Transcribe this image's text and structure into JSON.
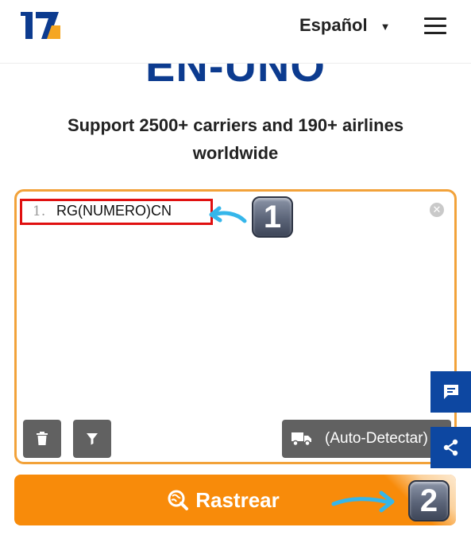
{
  "header": {
    "logo_text": "17",
    "language": "Español",
    "icons": {
      "menu": "hamburger-menu-icon",
      "caret": "caret-down-icon"
    }
  },
  "hero": {
    "title_fragment": "EN-UNO",
    "subtitle": "Support 2500+ carriers and 190+ airlines worldwide"
  },
  "tracking_input": {
    "line_number": "1.",
    "value": "RG(NUMERO)CN",
    "clear_icon": "clear-circle-icon"
  },
  "toolbar": {
    "delete_icon": "trash-icon",
    "filter_icon": "filter-icon",
    "carrier_label": "(Auto-Detectar)",
    "carrier_icon": "truck-icon"
  },
  "side_actions": {
    "chat_icon": "chat-icon",
    "share_icon": "share-icon"
  },
  "track_button": {
    "label": "Rastrear",
    "icon": "search-globe-icon"
  },
  "annotations": {
    "step1": "1",
    "step2": "2"
  },
  "colors": {
    "brand_blue": "#0c3b8f",
    "accent_orange": "#f88b0a",
    "input_border": "#f2a23a",
    "highlight_red": "#e01010",
    "side_blue": "#0d47a1",
    "tool_gray": "#616161",
    "annotation_arrow": "#35b6ea"
  }
}
